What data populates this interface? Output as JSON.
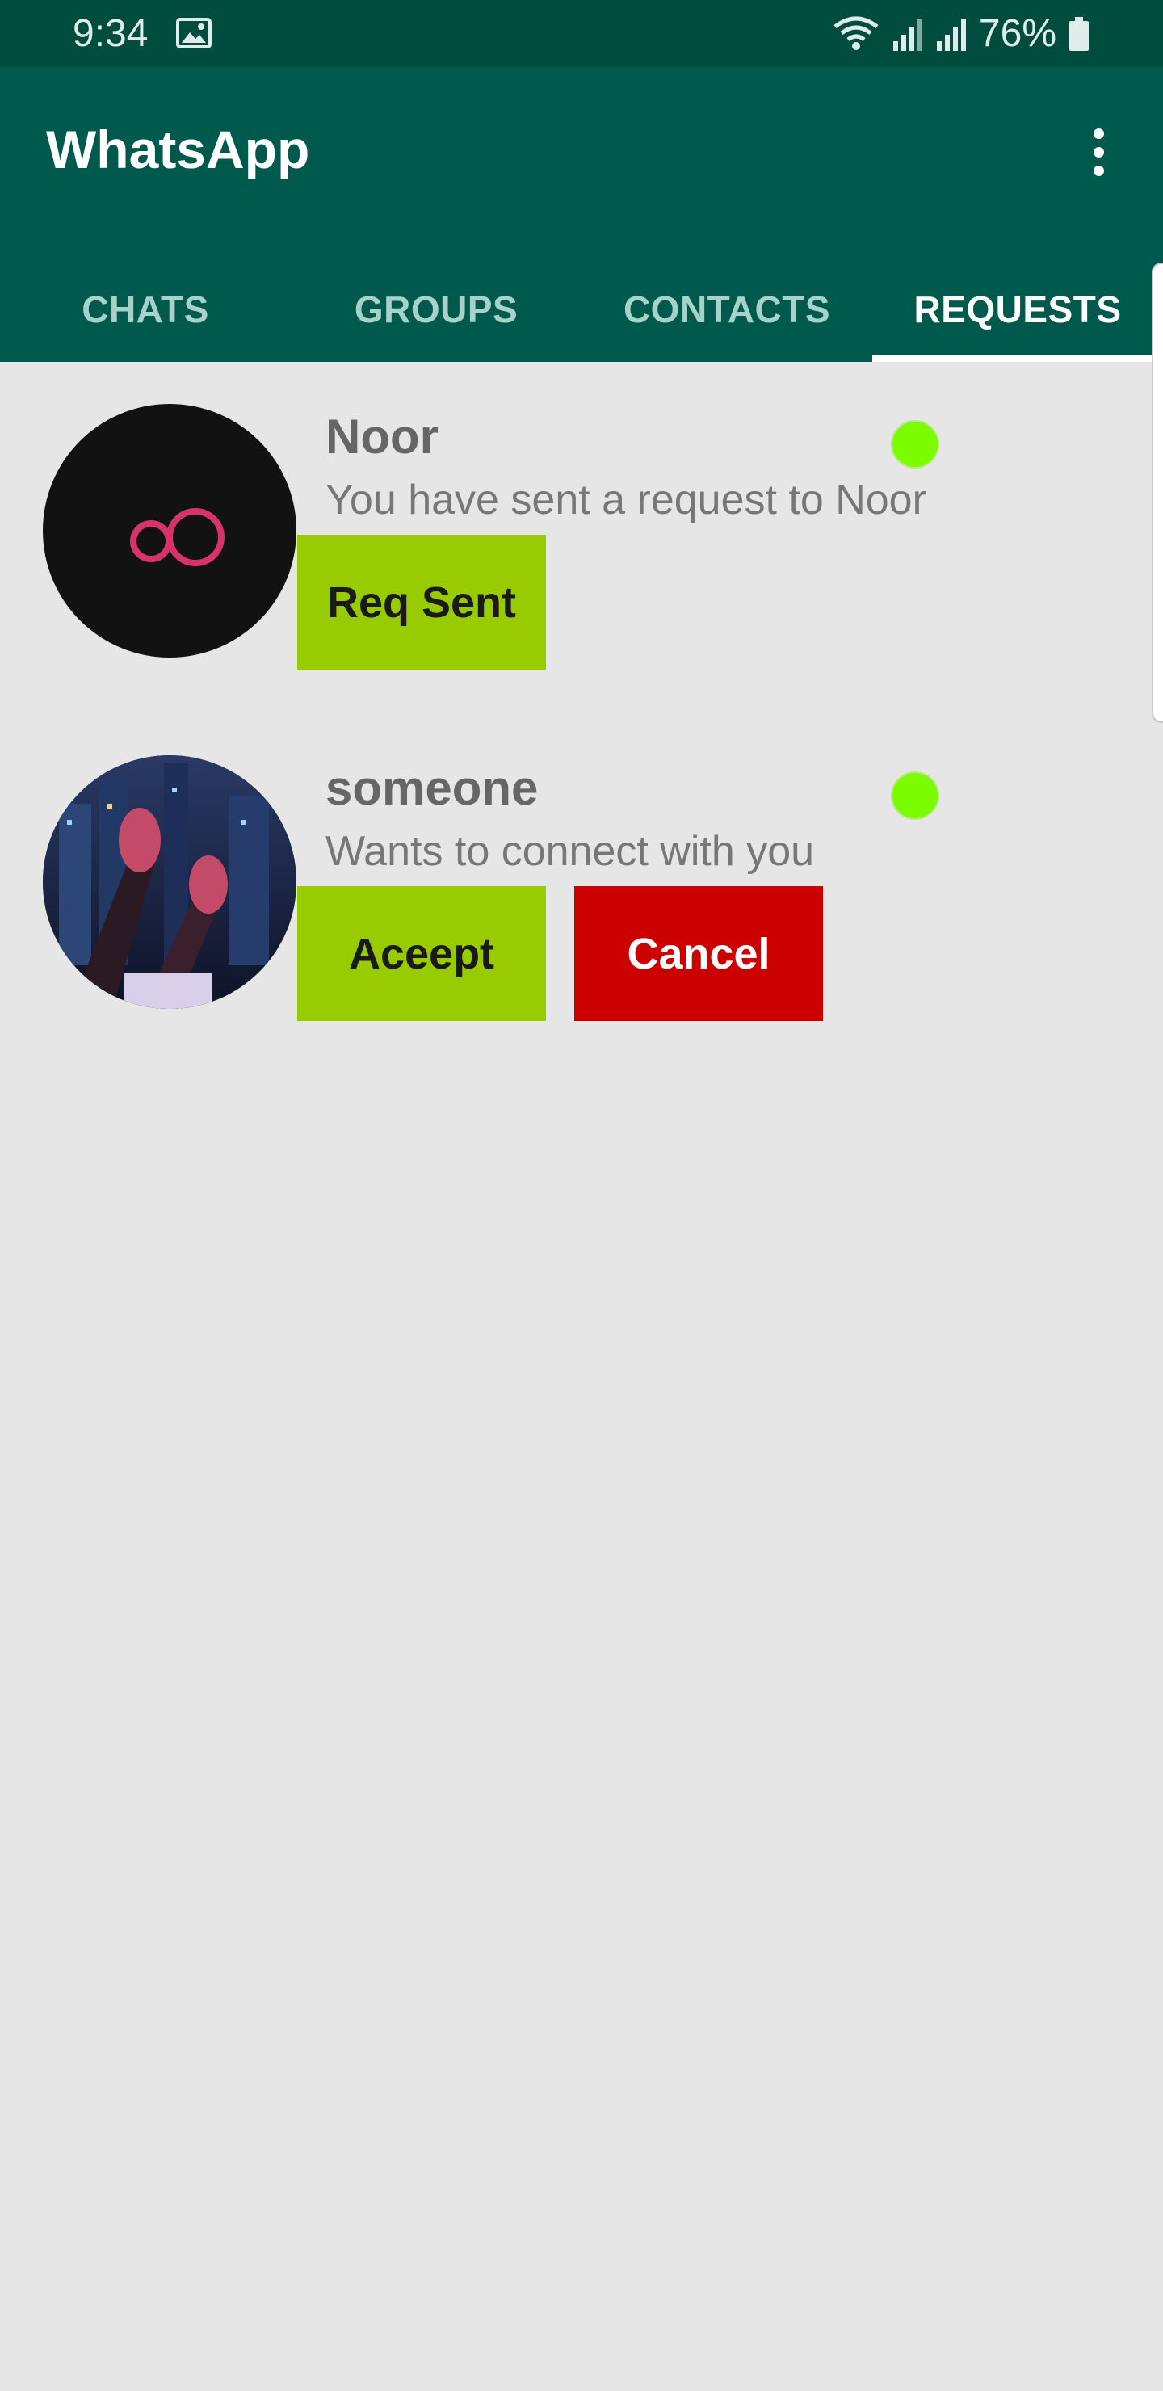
{
  "status_bar": {
    "time": "9:34",
    "battery": "76%",
    "icons": [
      "gallery-icon",
      "wifi-icon",
      "signal-icon",
      "signal-icon",
      "battery-icon"
    ]
  },
  "app_bar": {
    "title": "WhatsApp",
    "menu_icon": "more-vert-icon"
  },
  "tabs": [
    {
      "label": "CHATS"
    },
    {
      "label": "GROUPS"
    },
    {
      "label": "CONTACTS"
    },
    {
      "label": "REQUESTS",
      "active": true
    }
  ],
  "requests": [
    {
      "name": "Noor",
      "message": "You have sent a request to Noor",
      "status": "online",
      "buttons": [
        {
          "label": "Req Sent",
          "color": "#99cc00"
        }
      ]
    },
    {
      "name": "someone",
      "message": "Wants to connect with you",
      "status": "online",
      "buttons": [
        {
          "label": "Aceept",
          "color": "#99cc00"
        },
        {
          "label": "Cancel",
          "color": "#cc0000"
        }
      ]
    }
  ],
  "colors": {
    "status_bar": "#004d40",
    "app_bar": "#00594d",
    "background": "#e6e6e6",
    "online": "#7cfc00"
  }
}
